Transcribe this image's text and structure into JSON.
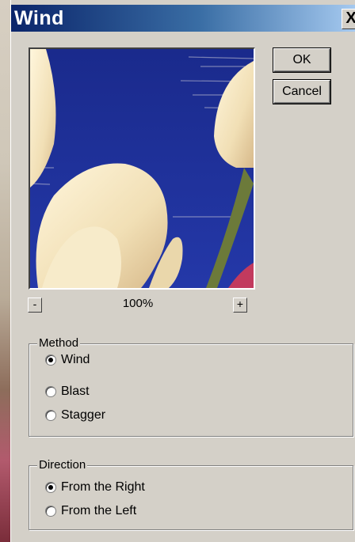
{
  "window": {
    "title": "Wind",
    "close_label": "X"
  },
  "buttons": {
    "ok": "OK",
    "cancel": "Cancel",
    "zoom_out": "-",
    "zoom_in": "+"
  },
  "zoom": "100%",
  "method": {
    "label": "Method",
    "options": [
      {
        "label": "Wind",
        "selected": true
      },
      {
        "label": "Blast",
        "selected": false
      },
      {
        "label": "Stagger",
        "selected": false
      }
    ]
  },
  "direction": {
    "label": "Direction",
    "options": [
      {
        "label": "From the Right",
        "selected": true
      },
      {
        "label": "From the Left",
        "selected": false
      }
    ]
  },
  "colors": {
    "titlebar": "#0a246a",
    "preview_sky": "#1e2f98",
    "petal": "#f3e6c3"
  }
}
